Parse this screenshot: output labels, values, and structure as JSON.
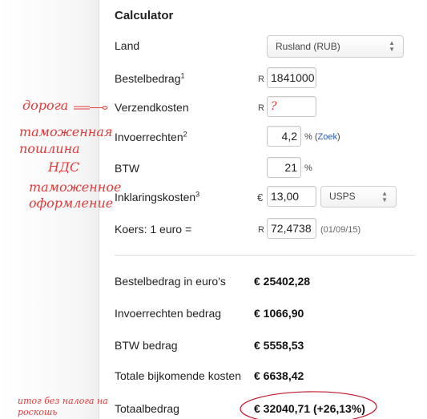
{
  "calculator": {
    "title": "Calculator",
    "land": {
      "label": "Land",
      "value": "Rusland (RUB)"
    },
    "bestelbedrag": {
      "label": "Bestelbedrag",
      "sup": "1",
      "currency": "R",
      "value": "1841000"
    },
    "verzendkosten": {
      "label": "Verzendkosten",
      "currency": "R",
      "value": "?"
    },
    "invoerrechten": {
      "label": "Invoerrechten",
      "sup": "2",
      "value": "4,2",
      "unit": "%",
      "link_open": "(",
      "link": "Zoek",
      "link_close": ")"
    },
    "btw": {
      "label": "BTW",
      "value": "21",
      "unit": "%"
    },
    "inklaringskosten": {
      "label": "Inklaringskosten",
      "sup": "3",
      "currency": "€",
      "value": "13,00",
      "carrier": "USPS"
    },
    "koers": {
      "label": "Koers: 1 euro =",
      "currency": "R",
      "value": "72,4738",
      "date": "(01/09/15)"
    }
  },
  "results": {
    "bestelbedrag_euro": {
      "label": "Bestelbedrag in euro's",
      "value": "€ 25402,28"
    },
    "invoerrechten_bedrag": {
      "label": "Invoerrechten bedrag",
      "value": "€ 1066,90"
    },
    "btw_bedrag": {
      "label": "BTW bedrag",
      "value": "€ 5558,53"
    },
    "totale_bijkomende": {
      "label": "Totale bijkomende kosten",
      "value": "€ 6638,42"
    },
    "totaalbedrag": {
      "label": "Totaalbedrag",
      "value": "€ 32040,71 (+26,13%)"
    }
  },
  "annotations": {
    "doroga": "дорога",
    "tamozh_1": "таможенная",
    "tamozh_2": "пошлина",
    "nds": "НДС",
    "oform_1": "таможенное",
    "oform_2": "оформление",
    "itog_1": "итог без налога на",
    "itog_2": "роскошь"
  },
  "colors": {
    "annotation": "#e03a3a",
    "link": "#2a5db0"
  }
}
